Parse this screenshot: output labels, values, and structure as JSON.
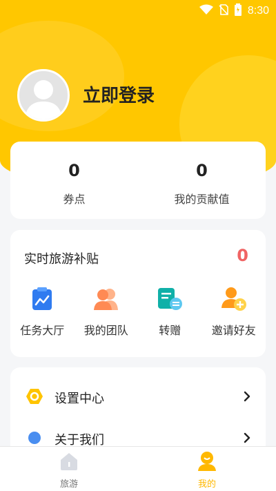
{
  "status_bar": {
    "time": "8:30"
  },
  "profile": {
    "login_label": "立即登录"
  },
  "stats": [
    {
      "value": "0",
      "label": "券点"
    },
    {
      "value": "0",
      "label": "我的贡献值"
    }
  ],
  "subsidy": {
    "title": "实时旅游补贴",
    "value": "0",
    "actions": [
      {
        "label": "任务大厅",
        "icon": "task-hall-icon"
      },
      {
        "label": "我的团队",
        "icon": "team-icon"
      },
      {
        "label": "转赠",
        "icon": "transfer-icon"
      },
      {
        "label": "邀请好友",
        "icon": "invite-friend-icon"
      }
    ]
  },
  "menu": [
    {
      "label": "设置中心",
      "icon": "settings-icon"
    },
    {
      "label": "关于我们",
      "icon": "about-icon"
    }
  ],
  "tabbar": [
    {
      "label": "旅游",
      "icon": "travel-icon",
      "active": false
    },
    {
      "label": "我的",
      "icon": "mine-icon",
      "active": true
    }
  ],
  "colors": {
    "accent": "#ffc700",
    "active_tab": "#ffb800",
    "subsidy_value": "#f06464",
    "inactive_tab": "#777777"
  }
}
